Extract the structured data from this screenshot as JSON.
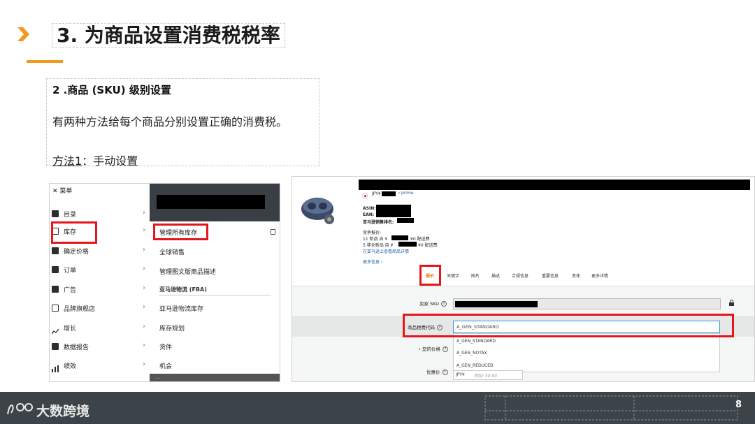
{
  "slide": {
    "title": "3. 为商品设置消费税税率",
    "subheading": "2 .商品 (SKU) 级别设置",
    "paragraph": "有两种方法给每个商品分别设置正确的消费税。",
    "method_label": "方法1",
    "method_rest": "：手动设置",
    "page_number": "8",
    "accent_color": "#f29a1f"
  },
  "menu": {
    "header": "✕ 菜单",
    "items": [
      {
        "label": "目录",
        "icon": "tag-icon"
      },
      {
        "label": "库存",
        "icon": "inventory-icon"
      },
      {
        "label": "确定价格",
        "icon": "price-icon"
      },
      {
        "label": "订单",
        "icon": "orders-icon"
      },
      {
        "label": "广告",
        "icon": "megaphone-icon"
      },
      {
        "label": "品牌旗舰店",
        "icon": "store-icon"
      },
      {
        "label": "增长",
        "icon": "growth-icon"
      },
      {
        "label": "数据报告",
        "icon": "reports-icon"
      },
      {
        "label": "绩效",
        "icon": "performance-icon"
      }
    ],
    "submenu": {
      "items": [
        "管理所有库存",
        "全球销售",
        "管理图文版商品描述"
      ],
      "section": "亚马逊物流 (FBA)",
      "fba_items": [
        "亚马逊物流库存",
        "库存规划",
        "货件",
        "机会"
      ],
      "bottom_left": "…",
      "bottom_right": "…"
    }
  },
  "product": {
    "currency_line_prefix": "JPY¥",
    "prime_label": "✓prime",
    "asin_label": "ASIN:",
    "ean_label": "EAN:",
    "rank_label": "亚马逊销售排名:",
    "competing_label": "竞争报价:",
    "new_offers": "11 新品 自 ¥",
    "new_shipping": "¥0 配送费",
    "used_offers": "5 非全新品 自 ¥",
    "used_shipping": "¥0 配送费",
    "view_link": "在亚马逊上查看商品详情",
    "more_info": "更多信息 ›",
    "tabs": [
      "报价",
      "关键字",
      "图片",
      "描述",
      "合规信息",
      "重要信息",
      "变体",
      "更多详情"
    ],
    "fields": {
      "sku_label": "卖家 SKU",
      "tax_label": "商品税费代码",
      "tax_value": "A_GEN_STANDARD",
      "price_label": "您的价格",
      "sale_label": "优惠价",
      "price_currency": "JPY¥",
      "price_placeholder": "例如: 50.00"
    },
    "tax_options": [
      "A_GEN_STANDARD",
      "A_GEN_NOTAX",
      "A_GEN_REDUCED"
    ]
  },
  "footer": {
    "brand": "大数跨境",
    "logo_text": "100"
  }
}
